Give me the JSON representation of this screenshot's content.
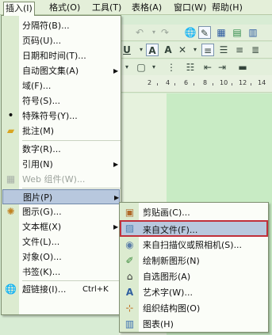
{
  "colors": {
    "menu_background": "#fbfdf8",
    "gutter": "#dcebd0",
    "highlight": "#b8c8de",
    "red_outline": "#c0303a",
    "document_green": "#c8ebc4"
  },
  "menubar": {
    "items": [
      {
        "label": "插入(I)"
      },
      {
        "label": "格式(O)"
      },
      {
        "label": "工具(T)"
      },
      {
        "label": "表格(A)"
      },
      {
        "label": "窗口(W)"
      },
      {
        "label": "帮助(H)"
      }
    ]
  },
  "toolbar1": {
    "icons": [
      "undo-icon",
      "redo-icon",
      "hyperlink-icon",
      "format-painter-icon",
      "table-icon",
      "excel-icon",
      "columns-icon"
    ]
  },
  "toolbar2": {
    "underline": "U",
    "char_a": "A",
    "char_a2": "A",
    "icons": [
      "char-border-icon",
      "char-shading-icon",
      "align-left-icon",
      "align-center-icon",
      "align-right-icon",
      "justify-icon"
    ]
  },
  "toolbar3": {
    "icons": [
      "border-icon",
      "numbering-icon",
      "bullets-icon",
      "decrease-indent-icon",
      "increase-indent-icon"
    ]
  },
  "ruler": {
    "ticks": [
      "2",
      "4",
      "6",
      "8",
      "10",
      "12",
      "14"
    ]
  },
  "insert_menu": {
    "items": [
      {
        "label": "分隔符(B)...",
        "icon": ""
      },
      {
        "label": "页码(U)...",
        "icon": ""
      },
      {
        "label": "日期和时间(T)...",
        "icon": ""
      },
      {
        "label": "自动图文集(A)",
        "icon": "",
        "submenu": true
      },
      {
        "label": "域(F)...",
        "icon": ""
      },
      {
        "label": "符号(S)...",
        "icon": ""
      },
      {
        "label": "特殊符号(Y)...",
        "icon": "bullet-icon"
      },
      {
        "label": "批注(M)",
        "icon": "comment-folder-icon"
      },
      {
        "label": "数字(R)...",
        "icon": ""
      },
      {
        "label": "引用(N)",
        "icon": "",
        "submenu": true
      },
      {
        "label": "Web 组件(W)...",
        "icon": "web-component-icon",
        "disabled": true
      },
      {
        "label": "图片(P)",
        "icon": "",
        "submenu": true,
        "highlight": true
      },
      {
        "label": "图示(G)...",
        "icon": "diagram-icon"
      },
      {
        "label": "文本框(X)",
        "icon": "",
        "submenu": true
      },
      {
        "label": "文件(L)...",
        "icon": ""
      },
      {
        "label": "对象(O)...",
        "icon": ""
      },
      {
        "label": "书签(K)...",
        "icon": ""
      },
      {
        "label": "超链接(I)...",
        "icon": "hyperlink-globe-icon",
        "shortcut": "Ctrl+K"
      }
    ]
  },
  "picture_submenu": {
    "items": [
      {
        "label": "剪贴画(C)...",
        "icon": "clipart-icon"
      },
      {
        "label": "来自文件(F)...",
        "icon": "from-file-icon",
        "highlight": true
      },
      {
        "label": "来自扫描仪或照相机(S)...",
        "icon": "scanner-camera-icon"
      },
      {
        "label": "绘制新图形(N)",
        "icon": "new-drawing-icon"
      },
      {
        "label": "自选图形(A)",
        "icon": "autoshape-icon"
      },
      {
        "label": "艺术字(W)...",
        "icon": "wordart-icon"
      },
      {
        "label": "组织结构图(O)",
        "icon": "org-chart-icon"
      },
      {
        "label": "图表(H)",
        "icon": "chart-icon"
      }
    ]
  }
}
